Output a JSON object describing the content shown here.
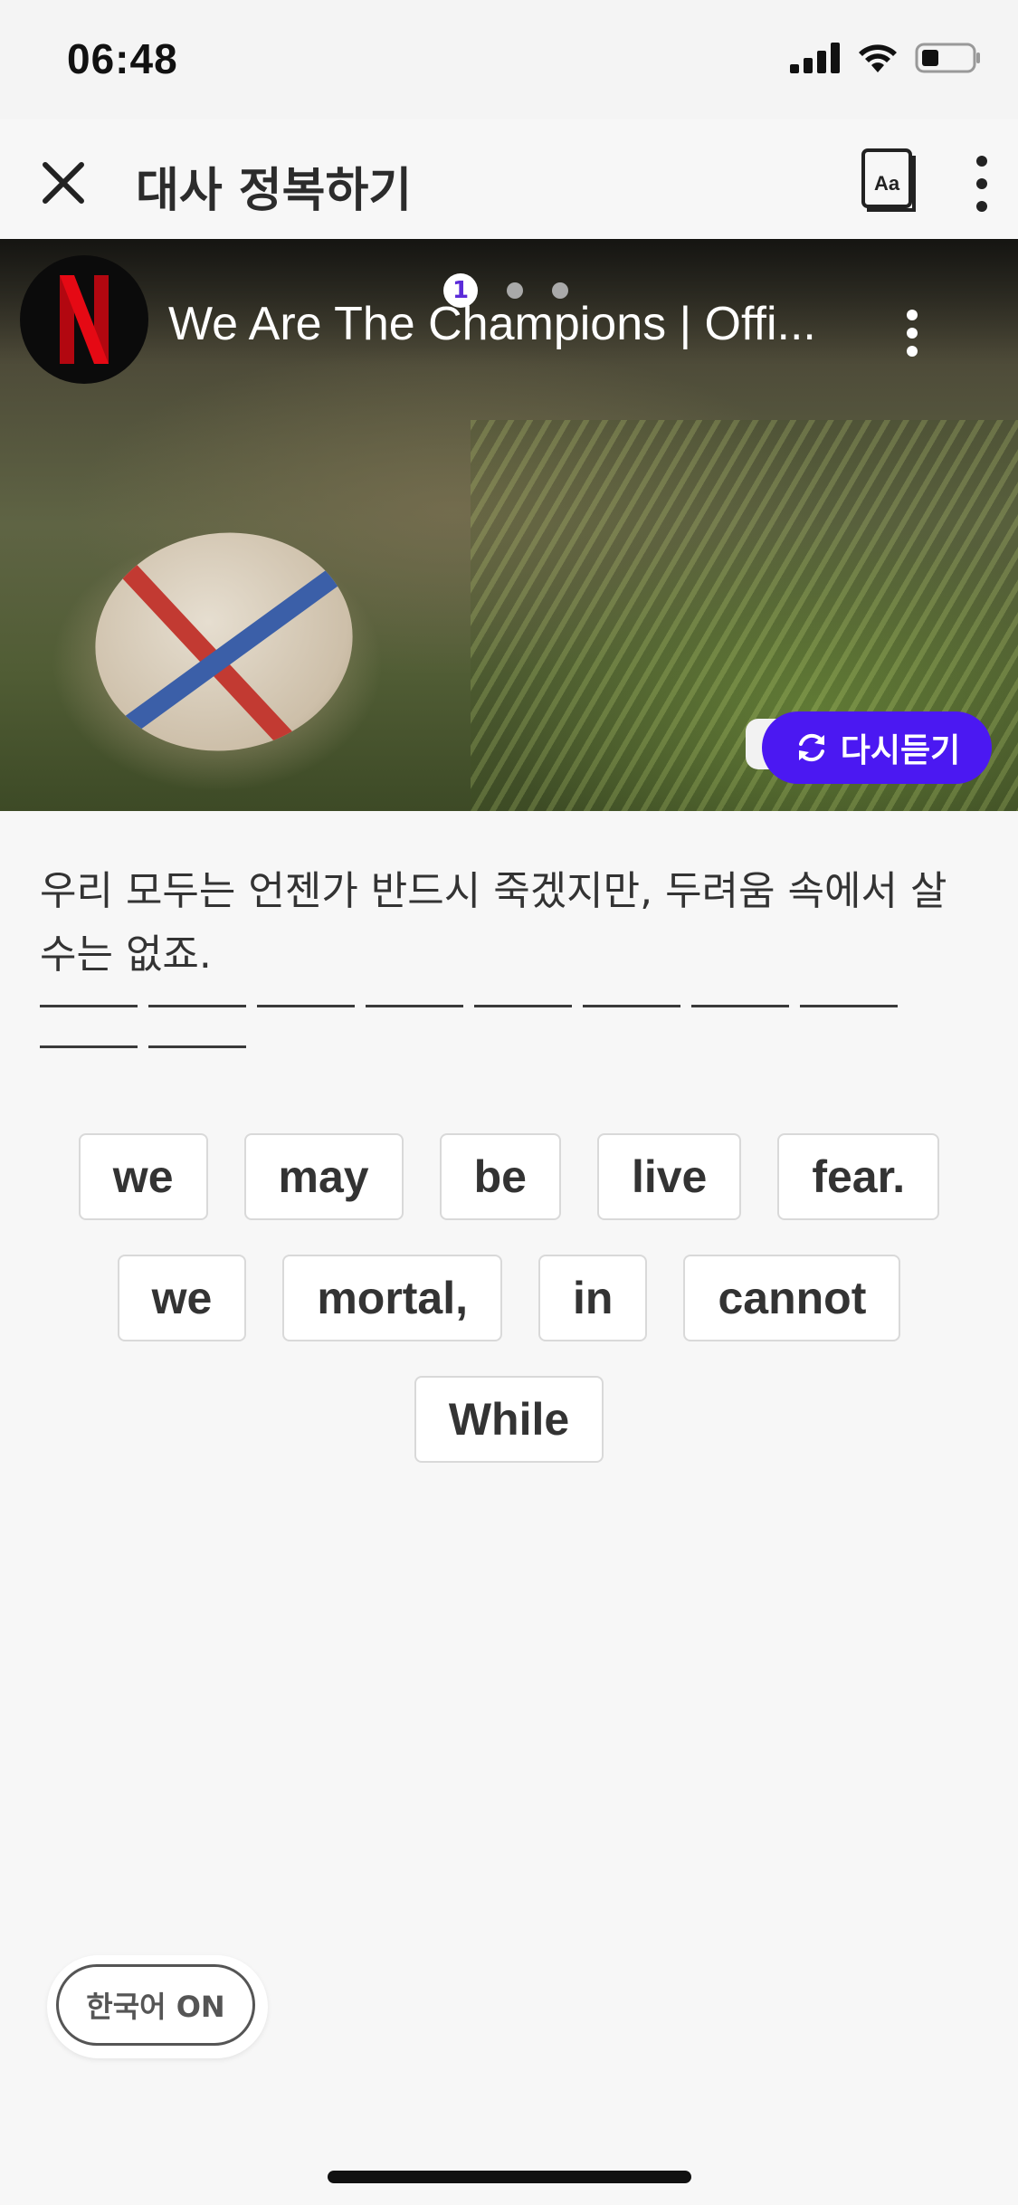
{
  "status_bar": {
    "time": "06:48"
  },
  "header": {
    "title": "대사 정복하기",
    "dict_icon_text": "Aa"
  },
  "video": {
    "channel_logo_letter": "N",
    "title": "We Are The Champions | Offi...",
    "page_indicator": {
      "current": "1",
      "total_dots": 3
    },
    "replay_label": "다시듣기",
    "brand_color": "#4b18f2"
  },
  "sentence_ko": "우리 모두는 언젠가 반드시 죽겠지만, 두려움 속에서 살 수는 없죠.",
  "blank_count": 10,
  "word_chips": [
    "we",
    "may",
    "be",
    "live",
    "fear.",
    "we",
    "mortal,",
    "in",
    "cannot",
    "While"
  ],
  "korean_toggle_label": "한국어 ON"
}
